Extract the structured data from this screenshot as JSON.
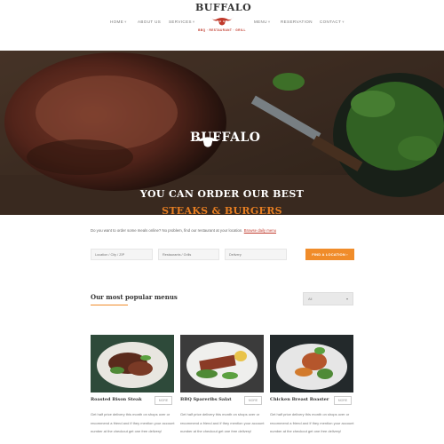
{
  "header": {
    "nav_left": [
      {
        "label": "HOME",
        "chevron": "▾"
      },
      {
        "label": "ABOUT US",
        "chevron": ""
      },
      {
        "label": "SERVICES",
        "chevron": "▾"
      }
    ],
    "nav_right": [
      {
        "label": "MENU",
        "chevron": "▾"
      },
      {
        "label": "RESERVATION",
        "chevron": ""
      },
      {
        "label": "CONTACT",
        "chevron": "▾"
      }
    ],
    "logo_title": "BUFFALO",
    "logo_tagline": "BBQ · RESTAURANT · GRILL"
  },
  "hero": {
    "logo_title": "BUFFALO",
    "headline_1": "YOU CAN ORDER OUR BEST",
    "headline_2": "STEAKS & BURGERS"
  },
  "order": {
    "intro_text": "Do you want to order some meals online? No problem, find our restaurant at your location.",
    "intro_link": "Browse daily menu",
    "location_placeholder": "Location / City / ZIP",
    "restaurant_placeholder": "Restaurants / Grills",
    "delivery_placeholder": "Delivery",
    "find_button": "FIND A LOCATION"
  },
  "popular": {
    "title": "Our most popular menus",
    "sort_value": "All",
    "sort_chevron": "▾",
    "cards": [
      {
        "name": "Roasted Bison Steak",
        "button": "MORE",
        "desc": "Get half price delivery this month on shops over or recommend a friend and if they mention your account number at the checkout get one free delivery!"
      },
      {
        "name": "BBQ Spareribs Salat",
        "button": "MORE",
        "desc": "Get half price delivery this month on shops over or recommend a friend and if they mention your account number at the checkout get one free delivery!"
      },
      {
        "name": "Chicken Breast Roaster",
        "button": "MORE",
        "desc": "Get half price delivery this month on shops over or recommend a friend and if they mention your account number at the checkout get one free delivery!"
      }
    ]
  },
  "colors": {
    "accent": "#f08c2a",
    "brand_red": "#c0392b"
  }
}
